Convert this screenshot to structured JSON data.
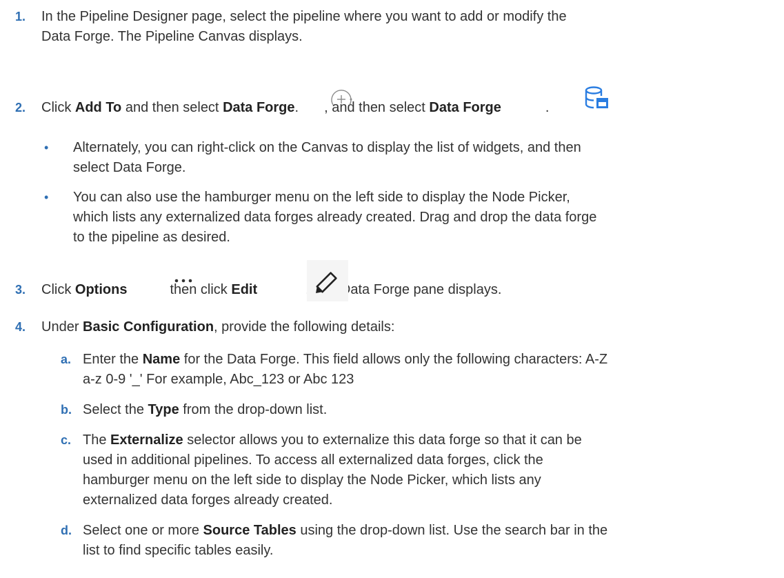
{
  "steps": [
    {
      "number": "1.",
      "line1": "In the Pipeline Designer page, select the pipeline where you want to add or modify the",
      "line2": "Data Forge. The Pipeline Canvas displays."
    },
    {
      "number": "2.",
      "t1": "Click ",
      "b1": "Add To",
      "t2": " and then select ",
      "b2": "Data Forge",
      "t3": ".",
      "t4": ", and then select ",
      "b3": "Data Forge",
      "t5": ".",
      "bullets": [
        {
          "line1": "Alternately, you can right-click on the Canvas to display the list of widgets, and then",
          "line2": "select Data Forge."
        },
        {
          "line1": "You can also use the hamburger menu on the left side to display the Node Picker,",
          "line2": "which lists any externalized data forges already created. Drag and drop the data forge",
          "line3": "to the pipeline as desired."
        }
      ]
    },
    {
      "number": "3.",
      "t1": "Click ",
      "b1": "Options",
      "t2": "then click ",
      "b2": "Edit",
      "t3": ". The Data Forge pane displays."
    },
    {
      "number": "4.",
      "t1": "Under ",
      "b1": "Basic Configuration",
      "t2": ", provide the following details:",
      "subs": [
        {
          "letter": "a.",
          "t1": "Enter the ",
          "b1": "Name",
          "t2": " for the Data Forge. This field allows only the following characters: A-Z",
          "line2": "a-z 0-9 '_' For example, Abc_123 or Abc 123"
        },
        {
          "letter": "b.",
          "t1": "Select the ",
          "b1": "Type",
          "t2": " from the drop-down list."
        },
        {
          "letter": "c.",
          "t1": "The ",
          "b1": "Externalize",
          "t2": " selector allows you to externalize this data forge so that it can be",
          "line2": "used in additional pipelines. To access all externalized data forges, click the",
          "line3": "hamburger menu on the left side to display the Node Picker, which lists any",
          "line4": "externalized data forges already created."
        },
        {
          "letter": "d.",
          "t1": "Select one or more ",
          "b1": "Source Tables",
          "t2": " using the drop-down list. Use the search bar in the",
          "line2": "list to find specific tables easily."
        }
      ]
    }
  ],
  "icons": {
    "add_to": "plus-circle-icon",
    "data_forge": "database-table-icon",
    "options": "ellipsis-icon",
    "edit": "pencil-icon"
  },
  "colors": {
    "numbering": "#2f6fb3",
    "body_text": "#333333"
  }
}
